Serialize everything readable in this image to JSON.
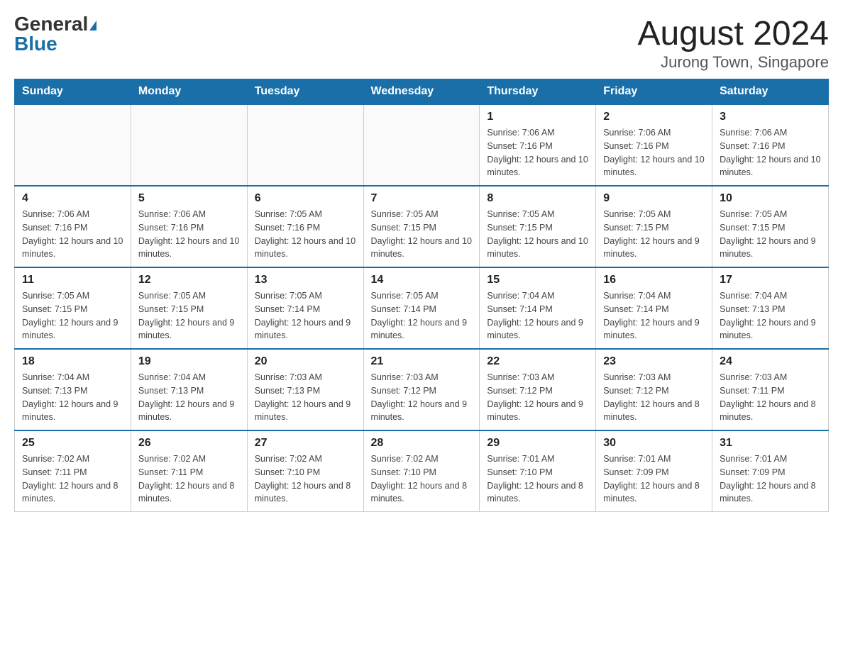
{
  "header": {
    "logo_general": "General",
    "logo_blue": "Blue",
    "month_title": "August 2024",
    "location": "Jurong Town, Singapore"
  },
  "days_of_week": [
    "Sunday",
    "Monday",
    "Tuesday",
    "Wednesday",
    "Thursday",
    "Friday",
    "Saturday"
  ],
  "weeks": [
    {
      "days": [
        {
          "num": "",
          "info": ""
        },
        {
          "num": "",
          "info": ""
        },
        {
          "num": "",
          "info": ""
        },
        {
          "num": "",
          "info": ""
        },
        {
          "num": "1",
          "info": "Sunrise: 7:06 AM\nSunset: 7:16 PM\nDaylight: 12 hours and 10 minutes."
        },
        {
          "num": "2",
          "info": "Sunrise: 7:06 AM\nSunset: 7:16 PM\nDaylight: 12 hours and 10 minutes."
        },
        {
          "num": "3",
          "info": "Sunrise: 7:06 AM\nSunset: 7:16 PM\nDaylight: 12 hours and 10 minutes."
        }
      ]
    },
    {
      "days": [
        {
          "num": "4",
          "info": "Sunrise: 7:06 AM\nSunset: 7:16 PM\nDaylight: 12 hours and 10 minutes."
        },
        {
          "num": "5",
          "info": "Sunrise: 7:06 AM\nSunset: 7:16 PM\nDaylight: 12 hours and 10 minutes."
        },
        {
          "num": "6",
          "info": "Sunrise: 7:05 AM\nSunset: 7:16 PM\nDaylight: 12 hours and 10 minutes."
        },
        {
          "num": "7",
          "info": "Sunrise: 7:05 AM\nSunset: 7:15 PM\nDaylight: 12 hours and 10 minutes."
        },
        {
          "num": "8",
          "info": "Sunrise: 7:05 AM\nSunset: 7:15 PM\nDaylight: 12 hours and 10 minutes."
        },
        {
          "num": "9",
          "info": "Sunrise: 7:05 AM\nSunset: 7:15 PM\nDaylight: 12 hours and 9 minutes."
        },
        {
          "num": "10",
          "info": "Sunrise: 7:05 AM\nSunset: 7:15 PM\nDaylight: 12 hours and 9 minutes."
        }
      ]
    },
    {
      "days": [
        {
          "num": "11",
          "info": "Sunrise: 7:05 AM\nSunset: 7:15 PM\nDaylight: 12 hours and 9 minutes."
        },
        {
          "num": "12",
          "info": "Sunrise: 7:05 AM\nSunset: 7:15 PM\nDaylight: 12 hours and 9 minutes."
        },
        {
          "num": "13",
          "info": "Sunrise: 7:05 AM\nSunset: 7:14 PM\nDaylight: 12 hours and 9 minutes."
        },
        {
          "num": "14",
          "info": "Sunrise: 7:05 AM\nSunset: 7:14 PM\nDaylight: 12 hours and 9 minutes."
        },
        {
          "num": "15",
          "info": "Sunrise: 7:04 AM\nSunset: 7:14 PM\nDaylight: 12 hours and 9 minutes."
        },
        {
          "num": "16",
          "info": "Sunrise: 7:04 AM\nSunset: 7:14 PM\nDaylight: 12 hours and 9 minutes."
        },
        {
          "num": "17",
          "info": "Sunrise: 7:04 AM\nSunset: 7:13 PM\nDaylight: 12 hours and 9 minutes."
        }
      ]
    },
    {
      "days": [
        {
          "num": "18",
          "info": "Sunrise: 7:04 AM\nSunset: 7:13 PM\nDaylight: 12 hours and 9 minutes."
        },
        {
          "num": "19",
          "info": "Sunrise: 7:04 AM\nSunset: 7:13 PM\nDaylight: 12 hours and 9 minutes."
        },
        {
          "num": "20",
          "info": "Sunrise: 7:03 AM\nSunset: 7:13 PM\nDaylight: 12 hours and 9 minutes."
        },
        {
          "num": "21",
          "info": "Sunrise: 7:03 AM\nSunset: 7:12 PM\nDaylight: 12 hours and 9 minutes."
        },
        {
          "num": "22",
          "info": "Sunrise: 7:03 AM\nSunset: 7:12 PM\nDaylight: 12 hours and 9 minutes."
        },
        {
          "num": "23",
          "info": "Sunrise: 7:03 AM\nSunset: 7:12 PM\nDaylight: 12 hours and 8 minutes."
        },
        {
          "num": "24",
          "info": "Sunrise: 7:03 AM\nSunset: 7:11 PM\nDaylight: 12 hours and 8 minutes."
        }
      ]
    },
    {
      "days": [
        {
          "num": "25",
          "info": "Sunrise: 7:02 AM\nSunset: 7:11 PM\nDaylight: 12 hours and 8 minutes."
        },
        {
          "num": "26",
          "info": "Sunrise: 7:02 AM\nSunset: 7:11 PM\nDaylight: 12 hours and 8 minutes."
        },
        {
          "num": "27",
          "info": "Sunrise: 7:02 AM\nSunset: 7:10 PM\nDaylight: 12 hours and 8 minutes."
        },
        {
          "num": "28",
          "info": "Sunrise: 7:02 AM\nSunset: 7:10 PM\nDaylight: 12 hours and 8 minutes."
        },
        {
          "num": "29",
          "info": "Sunrise: 7:01 AM\nSunset: 7:10 PM\nDaylight: 12 hours and 8 minutes."
        },
        {
          "num": "30",
          "info": "Sunrise: 7:01 AM\nSunset: 7:09 PM\nDaylight: 12 hours and 8 minutes."
        },
        {
          "num": "31",
          "info": "Sunrise: 7:01 AM\nSunset: 7:09 PM\nDaylight: 12 hours and 8 minutes."
        }
      ]
    }
  ]
}
